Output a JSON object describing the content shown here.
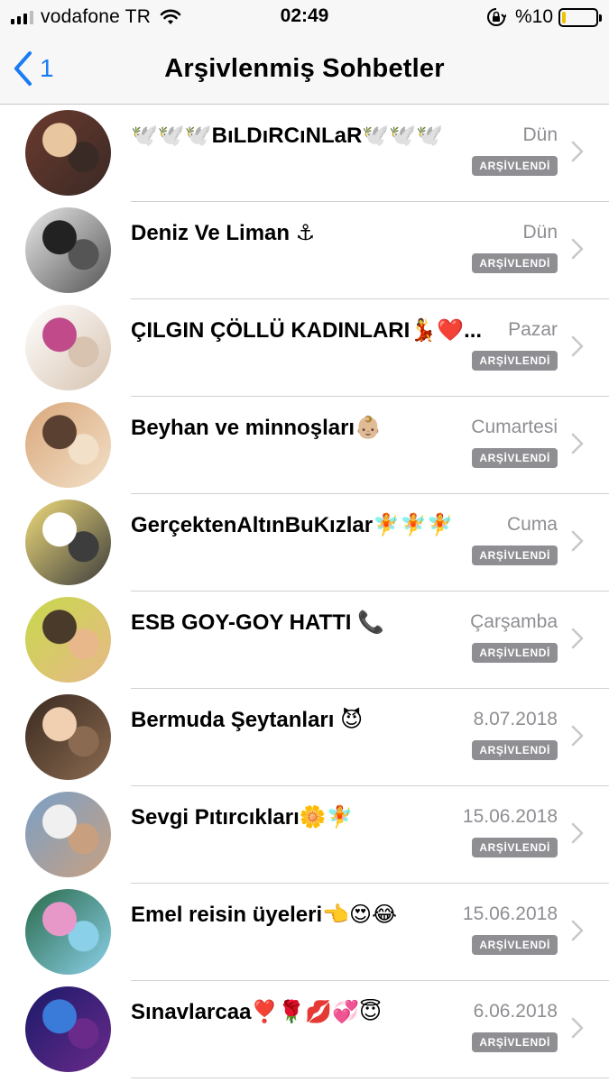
{
  "status_bar": {
    "carrier": "vodafone TR",
    "time": "02:49",
    "battery_percent": "%10",
    "battery_level": 0.1,
    "icons": [
      "signal-icon",
      "wifi-icon",
      "rotation-lock-icon",
      "battery-icon"
    ]
  },
  "nav": {
    "back_count": "1",
    "title": "Arşivlenmiş Sohbetler"
  },
  "colors": {
    "accent": "#1a7cf5",
    "badge": "#8e8e93",
    "battery": "#f2c200"
  },
  "badge_label": "ARŞİVLENDİ",
  "chats": [
    {
      "name": "🕊️🕊️🕊️BıLDıRCıNLaR🕊️🕊️🕊️",
      "date": "Dün",
      "avatar_colors": [
        "#6b3a2e",
        "#e8c7a0",
        "#3a2a25"
      ]
    },
    {
      "name": "Deniz Ve Liman ⚓",
      "date": "Dün",
      "avatar_colors": [
        "#e9e9e9",
        "#222222",
        "#555555"
      ]
    },
    {
      "name": "ÇILGIN ÇÖLLÜ KADINLARI💃❤️...",
      "date": "Pazar",
      "avatar_colors": [
        "#ffffff",
        "#c04a8a",
        "#d7c3b0"
      ]
    },
    {
      "name": "Beyhan ve minnoşları👶🏼",
      "date": "Cumartesi",
      "avatar_colors": [
        "#d9a87c",
        "#5a4030",
        "#f3e0c8"
      ]
    },
    {
      "name": "GerçektenAltınBuKızlar🧚🧚🧚",
      "date": "Cuma",
      "avatar_colors": [
        "#f0dc7a",
        "#ffffff",
        "#3d3d3d"
      ]
    },
    {
      "name": "ESB GOY-GOY HATTI 📞",
      "date": "Çarşamba",
      "avatar_colors": [
        "#c7d94a",
        "#4a3a2a",
        "#e8b88a"
      ]
    },
    {
      "name": "Bermuda Şeytanları 😈",
      "date": "8.07.2018",
      "avatar_colors": [
        "#3a2a20",
        "#f0d0b0",
        "#8a6a50"
      ]
    },
    {
      "name": "Sevgi Pıtırcıkları🌼🧚",
      "date": "15.06.2018",
      "avatar_colors": [
        "#7aa0c8",
        "#f0f0f0",
        "#c8a080"
      ]
    },
    {
      "name": "Emel reisin üyeleri👈😍😂",
      "date": "15.06.2018",
      "avatar_colors": [
        "#2a6a4a",
        "#e898c8",
        "#8ad0e8"
      ]
    },
    {
      "name": "Sınavlarcaa❣️🌹💋💞😇",
      "date": "6.06.2018",
      "avatar_colors": [
        "#1a1a6a",
        "#3a7ad8",
        "#6a2a8a"
      ]
    }
  ]
}
